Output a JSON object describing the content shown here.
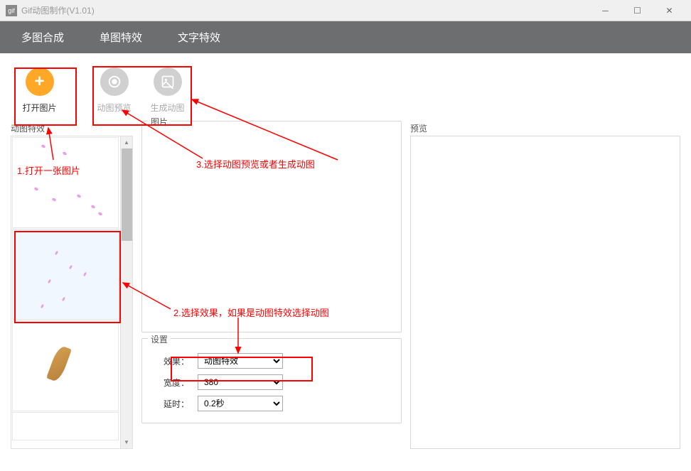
{
  "window": {
    "title": "Gif动图制作(V1.01)",
    "icon_text": "gif"
  },
  "menubar": {
    "items": [
      "多图合成",
      "单图特效",
      "文字特效"
    ]
  },
  "toolbar": {
    "open_image": "打开图片",
    "preview": "动图预览",
    "generate": "生成动图"
  },
  "left_panel": {
    "header": "动图特效"
  },
  "center_panel": {
    "image_header": "图片",
    "settings_header": "设置",
    "effect_label": "效果：",
    "effect_value": "动图特效",
    "width_label": "宽度：",
    "width_value": "380",
    "delay_label": "延时：",
    "delay_value": "0.2秒"
  },
  "right_panel": {
    "preview_header": "预览"
  },
  "annotations": {
    "a1": "1.打开一张图片",
    "a2": "2.选择效果，如果是动图特效选择动图",
    "a3": "3.选择动图预览或者生成动图"
  }
}
